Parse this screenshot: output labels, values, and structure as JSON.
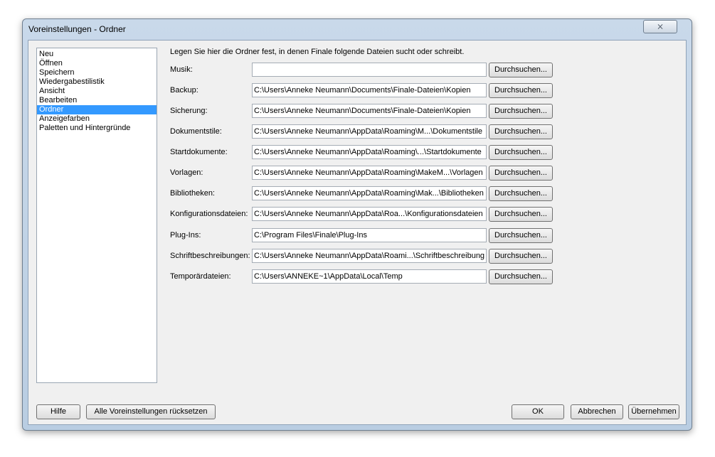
{
  "window": {
    "title": "Voreinstellungen - Ordner",
    "close_label": "⨯"
  },
  "sidebar": {
    "items": [
      {
        "label": "Neu",
        "selected": false
      },
      {
        "label": "Öffnen",
        "selected": false
      },
      {
        "label": "Speichern",
        "selected": false
      },
      {
        "label": "Wiedergabestilistik",
        "selected": false
      },
      {
        "label": "Ansicht",
        "selected": false
      },
      {
        "label": "Bearbeiten",
        "selected": false
      },
      {
        "label": "Ordner",
        "selected": true
      },
      {
        "label": "Anzeigefarben",
        "selected": false
      },
      {
        "label": "Paletten und Hintergründe",
        "selected": false
      }
    ]
  },
  "main": {
    "intro": "Legen Sie hier die Ordner fest, in denen Finale folgende Dateien sucht oder schreibt.",
    "browse_label": "Durchsuchen...",
    "rows": [
      {
        "label": "Musik:",
        "value": ""
      },
      {
        "label": "Backup:",
        "value": "C:\\Users\\Anneke Neumann\\Documents\\Finale-Dateien\\Kopien"
      },
      {
        "label": "Sicherung:",
        "value": "C:\\Users\\Anneke Neumann\\Documents\\Finale-Dateien\\Kopien"
      },
      {
        "label": "Dokumentstile:",
        "value": "C:\\Users\\Anneke Neumann\\AppData\\Roaming\\M...\\Dokumentstile"
      },
      {
        "label": "Startdokumente:",
        "value": "C:\\Users\\Anneke Neumann\\AppData\\Roaming\\...\\Startdokumente"
      },
      {
        "label": "Vorlagen:",
        "value": "C:\\Users\\Anneke Neumann\\AppData\\Roaming\\MakeM...\\Vorlagen"
      },
      {
        "label": "Bibliotheken:",
        "value": "C:\\Users\\Anneke Neumann\\AppData\\Roaming\\Mak...\\Bibliotheken"
      },
      {
        "label": "Konfigurationsdateien:",
        "value": "C:\\Users\\Anneke Neumann\\AppData\\Roa...\\Konfigurationsdateien"
      },
      {
        "label": "Plug-Ins:",
        "value": "C:\\Program Files\\Finale\\Plug-Ins"
      },
      {
        "label": "Schriftbeschreibungen:",
        "value": "C:\\Users\\Anneke Neumann\\AppData\\Roami...\\Schriftbeschreibung"
      },
      {
        "label": "Temporärdateien:",
        "value": "C:\\Users\\ANNEKE~1\\AppData\\Local\\Temp"
      }
    ]
  },
  "footer": {
    "help": "Hilfe",
    "reset_all": "Alle Voreinstellungen rücksetzen",
    "ok": "OK",
    "cancel": "Abbrechen",
    "apply": "Übernehmen"
  }
}
